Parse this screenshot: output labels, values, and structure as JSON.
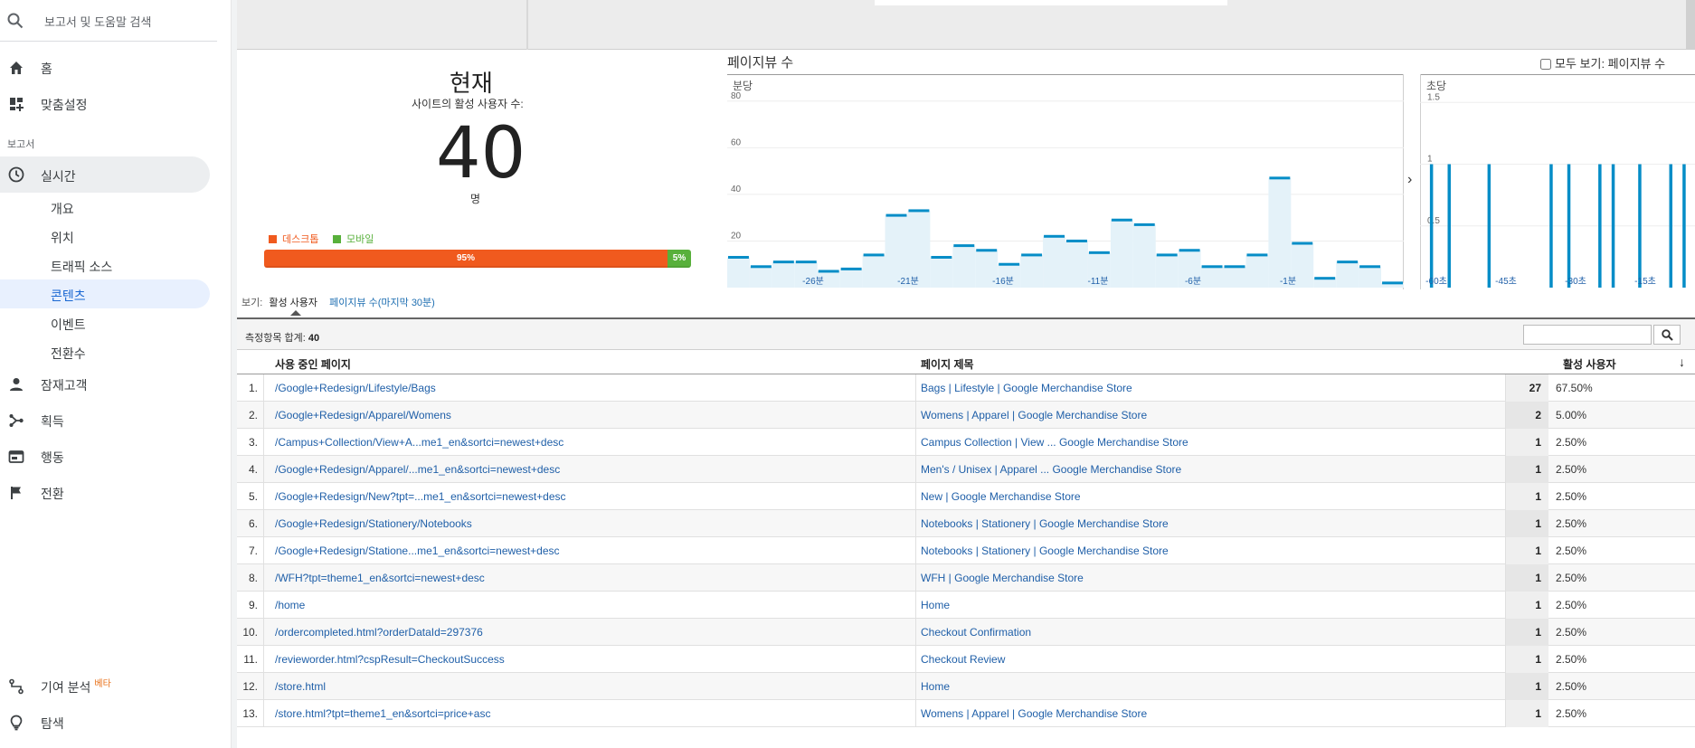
{
  "sidebar": {
    "search_placeholder": "보고서 및 도움말 검색",
    "home": "홈",
    "custom": "맞춤설정",
    "reports_label": "보고서",
    "realtime": "실시간",
    "sub_items": [
      "개요",
      "위치",
      "트래픽 소스",
      "콘텐츠",
      "이벤트",
      "전환수"
    ],
    "audience": "잠재고객",
    "acquisition": "획득",
    "behavior": "행동",
    "conversions": "전환",
    "attribution": "기여 분석",
    "beta": "베타",
    "discover": "탐색"
  },
  "now": {
    "title": "현재",
    "subtitle": "사이트의 활성 사용자 수:",
    "count": "40",
    "unit": "명",
    "legend_desktop": "데스크톱",
    "legend_mobile": "모바일",
    "desktop_pct_label": "95%",
    "mobile_pct_label": "5%",
    "desktop_share": 0.95,
    "colors": {
      "desktop": "#f05a1e",
      "mobile": "#58b03b"
    }
  },
  "charts": {
    "title": "페이지뷰 수",
    "all_view_label": "모두 보기: 페이지뷰 수",
    "per_minute_caption": "분당",
    "per_second_caption": "초당",
    "arrow": "›"
  },
  "chart_data": [
    {
      "type": "bar",
      "title": "분당",
      "ylim": [
        0,
        90
      ],
      "y_ticks": [
        20,
        40,
        60,
        80
      ],
      "x_tick_labels": [
        "-26분",
        "-21분",
        "-16분",
        "-11분",
        "-6분",
        "-1분"
      ],
      "values": [
        13,
        9,
        11,
        11,
        7,
        8,
        14,
        31,
        33,
        13,
        18,
        16,
        10,
        14,
        22,
        20,
        15,
        29,
        27,
        14,
        16,
        9,
        9,
        14,
        47,
        19,
        4,
        11,
        9,
        2
      ],
      "color": "#058dc7",
      "fill": "#e4f2f9"
    },
    {
      "type": "bar",
      "title": "초당",
      "ylim": [
        0,
        1.7
      ],
      "y_ticks": [
        0.5,
        1,
        1.5
      ],
      "x_tick_labels": [
        "-60초",
        "-45초",
        "-30초",
        "-15초"
      ],
      "spike_seconds_ago": [
        59,
        55,
        46,
        32,
        28,
        21,
        18,
        12,
        5,
        2
      ],
      "color": "#058dc7"
    }
  ],
  "view": {
    "label": "보기:",
    "active_tab": "활성 사용자",
    "other_tab": "페이지뷰 수(마지막 30분)"
  },
  "table": {
    "metric_label": "측정항목 합계:",
    "metric_total": "40",
    "col_page": "사용 중인 페이지",
    "col_title": "페이지 제목",
    "col_users": "활성 사용자",
    "sort_icon": "↓",
    "rows": [
      {
        "num": "1.",
        "page": "/Google+Redesign/Lifestyle/Bags",
        "title": "Bags | Lifestyle | Google Merchandise Store",
        "users": "27",
        "pct": "67.50%"
      },
      {
        "num": "2.",
        "page": "/Google+Redesign/Apparel/Womens",
        "title": "Womens | Apparel | Google Merchandise Store",
        "users": "2",
        "pct": "5.00%"
      },
      {
        "num": "3.",
        "page": "/Campus+Collection/View+A...me1_en&sortci=newest+desc",
        "title": "Campus Collection | View ... Google Merchandise Store",
        "users": "1",
        "pct": "2.50%"
      },
      {
        "num": "4.",
        "page": "/Google+Redesign/Apparel/...me1_en&sortci=newest+desc",
        "title": "Men's / Unisex | Apparel ... Google Merchandise Store",
        "users": "1",
        "pct": "2.50%"
      },
      {
        "num": "5.",
        "page": "/Google+Redesign/New?tpt=...me1_en&sortci=newest+desc",
        "title": "New | Google Merchandise Store",
        "users": "1",
        "pct": "2.50%"
      },
      {
        "num": "6.",
        "page": "/Google+Redesign/Stationery/Notebooks",
        "title": "Notebooks | Stationery | Google Merchandise Store",
        "users": "1",
        "pct": "2.50%"
      },
      {
        "num": "7.",
        "page": "/Google+Redesign/Statione...me1_en&sortci=newest+desc",
        "title": "Notebooks | Stationery | Google Merchandise Store",
        "users": "1",
        "pct": "2.50%"
      },
      {
        "num": "8.",
        "page": "/WFH?tpt=theme1_en&sortci=newest+desc",
        "title": "WFH | Google Merchandise Store",
        "users": "1",
        "pct": "2.50%"
      },
      {
        "num": "9.",
        "page": "/home",
        "title": "Home",
        "users": "1",
        "pct": "2.50%"
      },
      {
        "num": "10.",
        "page": "/ordercompleted.html?orderDataId=297376",
        "title": "Checkout Confirmation",
        "users": "1",
        "pct": "2.50%"
      },
      {
        "num": "11.",
        "page": "/revieworder.html?cspResult=CheckoutSuccess",
        "title": "Checkout Review",
        "users": "1",
        "pct": "2.50%"
      },
      {
        "num": "12.",
        "page": "/store.html",
        "title": "Home",
        "users": "1",
        "pct": "2.50%"
      },
      {
        "num": "13.",
        "page": "/store.html?tpt=theme1_en&sortci=price+asc",
        "title": "Womens | Apparel | Google Merchandise Store",
        "users": "1",
        "pct": "2.50%"
      }
    ]
  }
}
